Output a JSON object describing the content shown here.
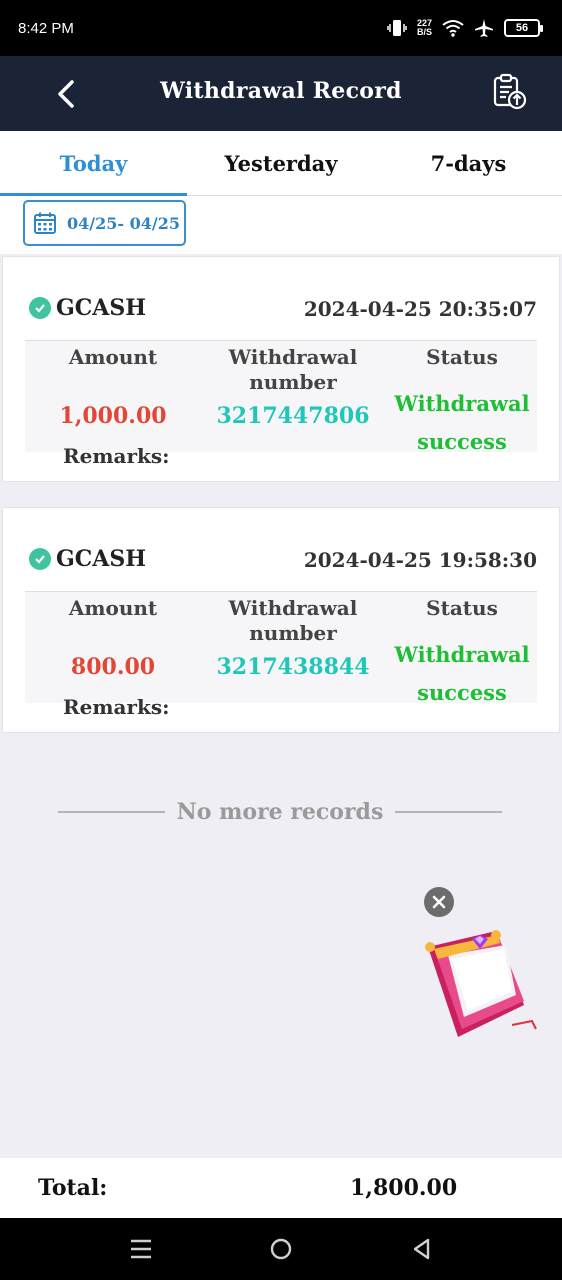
{
  "status_bar": {
    "time": "8:42 PM",
    "net_speed_value": "227",
    "net_speed_unit": "B/S",
    "battery": "56",
    "icons": [
      "vibrate-icon",
      "wifi-icon",
      "airplane-icon",
      "battery-icon"
    ]
  },
  "header": {
    "title": "Withdrawal Record",
    "back_icon": "chevron-left-icon",
    "export_icon": "clipboard-upload-icon"
  },
  "tabs": [
    {
      "label": "Today",
      "active": true
    },
    {
      "label": "Yesterday",
      "active": false
    },
    {
      "label": "7-days",
      "active": false
    }
  ],
  "date_filter": {
    "label": "04/25- 04/25",
    "icon": "calendar-icon"
  },
  "table_headers": {
    "amount": "Amount",
    "number_line1": "Withdrawal",
    "number_line2": "number",
    "status": "Status",
    "remarks": "Remarks:"
  },
  "records": [
    {
      "provider": "GCASH",
      "datetime": "2024-04-25 20:35:07",
      "amount": "1,000.00",
      "number": "3217447806",
      "status_line1": "Withdrawal",
      "status_line2": "success",
      "remarks": ""
    },
    {
      "provider": "GCASH",
      "datetime": "2024-04-25 19:58:30",
      "amount": "800.00",
      "number": "3217438844",
      "status_line1": "Withdrawal",
      "status_line2": "success",
      "remarks": ""
    }
  ],
  "no_more": "No more records",
  "total": {
    "label": "Total:",
    "value": "1,800.00"
  },
  "colors": {
    "header_bg": "#1b2336",
    "accent": "#2f8fd6",
    "amount": "#e24637",
    "number": "#1fc7b8",
    "success": "#1fbf35"
  }
}
